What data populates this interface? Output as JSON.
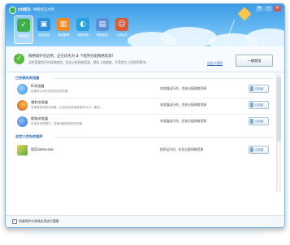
{
  "window": {
    "title": "QQ医生",
    "subtitle": "网络优先大师",
    "controls": [
      "menu-icon",
      "minimize-icon",
      "close-icon"
    ]
  },
  "tabs": [
    {
      "label": "网速保护",
      "icon": "shield-icon",
      "color": "#3fae49",
      "glyph": "✓"
    },
    {
      "label": "流量监控",
      "icon": "monitor-icon",
      "color": "#2f8fd8",
      "glyph": "▣"
    },
    {
      "label": "流量管理",
      "icon": "traffic-icon",
      "color": "#f08a24",
      "glyph": "▥"
    },
    {
      "label": "网络测速",
      "icon": "speed-icon",
      "color": "#2aa0d9",
      "glyph": "◐"
    },
    {
      "label": "网络测试",
      "icon": "test-icon",
      "color": "#5c8fd6",
      "glyph": "▤"
    },
    {
      "label": "上网医生",
      "icon": "doctor-icon",
      "color": "#d45d3a",
      "glyph": "☺"
    }
  ],
  "status": {
    "main_prefix": "网络保护已启用，正在优先为",
    "count": "4",
    "main_suffix": "个程序分配网络资源！",
    "description": "适时管理程序的网络使用，优化分配网络资源，提高上网速度，不受其它上网程序影响。",
    "settings_link": "自定义规则",
    "action_button": "一键禁用"
  },
  "sections": [
    {
      "title": "已安装的浏览器",
      "apps": [
        {
          "name": "IE浏览器",
          "desc": "由微软公司开发的网页浏览器",
          "status": "浏览器运行时，优化分配网络资源",
          "toggle": "已启用",
          "icon": "ie-icon",
          "color": "#2b8de0"
        },
        {
          "name": "猎豹浏览器",
          "desc": "全球首款双核浏览器，比传统浏览速度更快30%，集成...",
          "status": "浏览器运行时，优化分配网络资源",
          "toggle": "已启用",
          "icon": "firefox-icon",
          "color": "#e6772a"
        },
        {
          "name": "搜狗浏览器",
          "desc": "采用多标签模式，快速流畅的新型浏览器",
          "status": "浏览器运行时，优化分配网络资源",
          "toggle": "已启用",
          "icon": "sogou-icon",
          "color": "#2f6fd8"
        }
      ]
    },
    {
      "title": "自定义优先的程序",
      "apps": [
        {
          "name": "QQGame.exe",
          "desc": "",
          "status": "程序运行时，优化分配网络资源",
          "toggle": "已启用",
          "icon": "qqgame-icon",
          "color": "#4caf50"
        }
      ]
    }
  ],
  "footer": {
    "checkbox_label": "网速保护对游戏应用进行提醒",
    "checked": true
  }
}
